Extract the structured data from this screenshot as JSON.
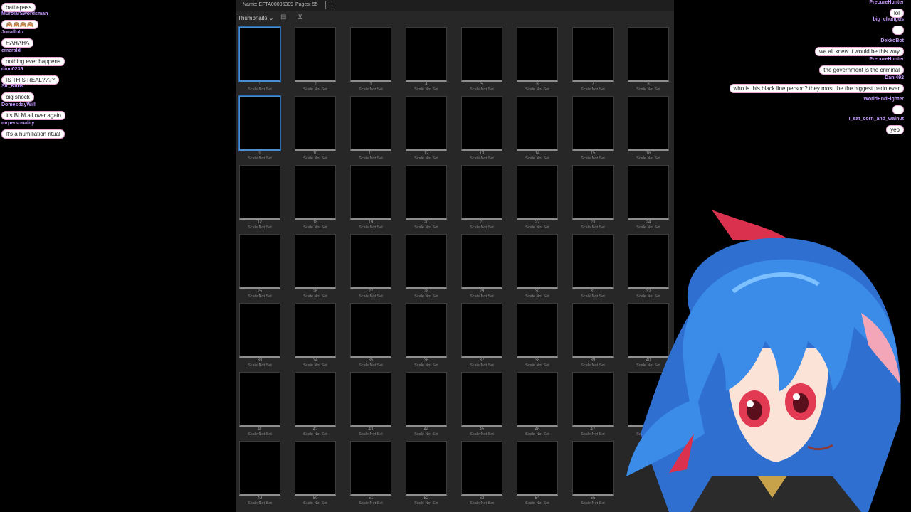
{
  "viewer": {
    "name_label": "Name: EFTA00006309",
    "pages_label": "Pages: 55",
    "thumbnails_label": "Thumbnails ⌄",
    "scale_text": "Scale Not Set",
    "page_count": 55,
    "selected_pages": [
      1,
      9
    ]
  },
  "chat_left": [
    {
      "user": "",
      "message": "battlepass"
    },
    {
      "user": "MurolarSwordsman",
      "message": "🙈🙈🙈🙈"
    },
    {
      "user": "Jucalloto",
      "message": "HAHAHA"
    },
    {
      "user": "emerald",
      "message": "nothing ever happens"
    },
    {
      "user": "dino0235",
      "message": "IS THIS REAL????"
    },
    {
      "user": "Sir_Khris",
      "message": "big shock"
    },
    {
      "user": "DomesdayWill",
      "message": "it's BLM all over again"
    },
    {
      "user": "mrpersonality",
      "message": "It's a humiliation ritual"
    }
  ],
  "chat_right": [
    {
      "user": "PrecureHunter",
      "message": "lol"
    },
    {
      "user": "big_chungus",
      "message": ""
    },
    {
      "user": "DekkoBot",
      "message": "we all knew it would be this way"
    },
    {
      "user": "PrecureHunter",
      "message": "the government is the criminal"
    },
    {
      "user": "Dani492",
      "message": "who is this black line person? they most the the biggest pedo ever"
    },
    {
      "user": "WorldEndFighter",
      "message": ""
    },
    {
      "user": "I_eat_corn_and_walnut",
      "message": "yep"
    }
  ],
  "colors": {
    "viewer_bg": "#272727",
    "selection": "#4a8fd1",
    "chat_username": "#c79bff",
    "avatar_hair": "#3b8be8",
    "avatar_eyes": "#e23a52"
  }
}
